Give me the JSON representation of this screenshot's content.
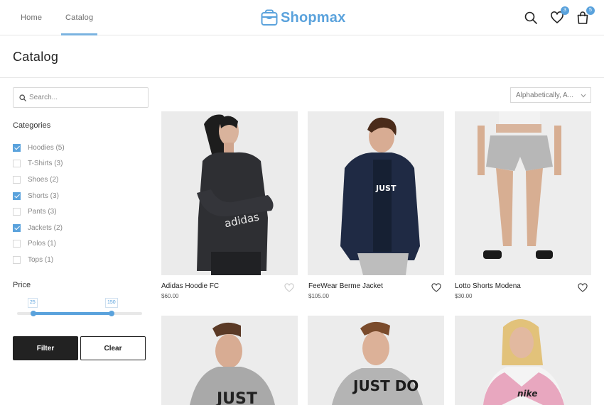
{
  "nav": {
    "home": "Home",
    "catalog": "Catalog"
  },
  "brand": {
    "name": "Shopmax",
    "color": "#5aa2dc"
  },
  "header_icons": {
    "search": "search-icon",
    "wishlist": "heart-icon",
    "cart": "bag-icon",
    "wishlist_count": "3",
    "cart_count": "5"
  },
  "page": {
    "title": "Catalog"
  },
  "search": {
    "placeholder": "Search..."
  },
  "sort": {
    "selected": "Alphabetically, A..."
  },
  "categories": {
    "title": "Categories",
    "items": [
      {
        "label": "Hoodies (5)",
        "checked": true
      },
      {
        "label": "T-Shirts (3)",
        "checked": false
      },
      {
        "label": "Shoes (2)",
        "checked": false
      },
      {
        "label": "Shorts (3)",
        "checked": true
      },
      {
        "label": "Pants (3)",
        "checked": false
      },
      {
        "label": "Jackets (2)",
        "checked": true
      },
      {
        "label": "Polos (1)",
        "checked": false
      },
      {
        "label": "Tops (1)",
        "checked": false
      }
    ]
  },
  "price": {
    "title": "Price",
    "min": "25",
    "max": "150"
  },
  "buttons": {
    "filter": "Filter",
    "clear": "Clear"
  },
  "products": [
    {
      "name": "Adidas Hoodie FC",
      "price": "$60.00"
    },
    {
      "name": "FeeWear Berme Jacket",
      "price": "$105.00"
    },
    {
      "name": "Lotto Shorts Modena",
      "price": "$30.00"
    },
    {
      "name": "",
      "price": ""
    },
    {
      "name": "",
      "price": ""
    },
    {
      "name": "",
      "price": ""
    }
  ],
  "image_prints": {
    "hoodie_1": "adidas",
    "jacket": "JUST",
    "sweat_1": "JUST",
    "sweat_2": "JUST DO",
    "nike": "nike"
  }
}
